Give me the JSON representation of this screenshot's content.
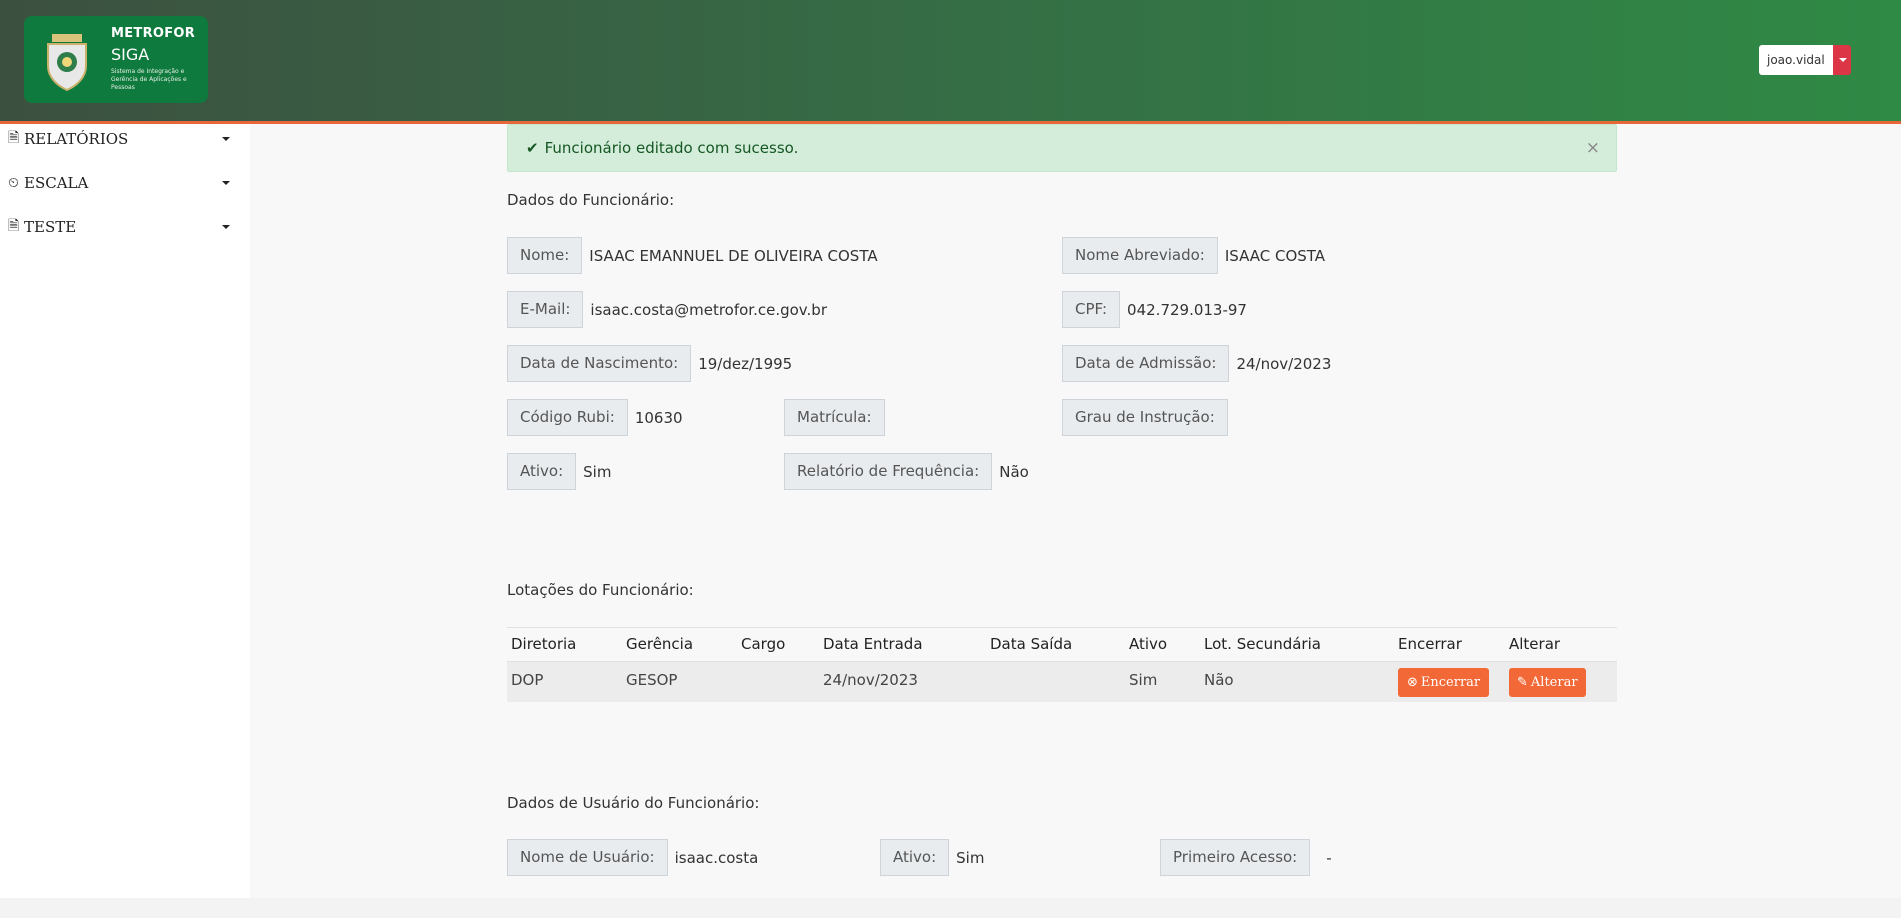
{
  "header": {
    "logo_title": "METROFOR",
    "logo_sub": "SIGA",
    "logo_desc": "Sistema de Integração e Gerência de Aplicações e Pessoas",
    "user": "joao.vidal"
  },
  "sidebar": {
    "items": [
      {
        "label": "RELATÓRIOS",
        "icon": "file-icon"
      },
      {
        "label": "ESCALA",
        "icon": "clock-icon"
      },
      {
        "label": "TESTE",
        "icon": "file-icon"
      }
    ]
  },
  "alert": {
    "message": "Funcionário editado com sucesso.",
    "close": "×"
  },
  "employee": {
    "section_title": "Dados do Funcionário:",
    "nome_label": "Nome:",
    "nome": "ISAAC EMANNUEL DE OLIVEIRA COSTA",
    "nome_abrev_label": "Nome Abreviado:",
    "nome_abrev": "ISAAC COSTA",
    "email_label": "E-Mail:",
    "email": "isaac.costa@metrofor.ce.gov.br",
    "cpf_label": "CPF:",
    "cpf": "042.729.013-97",
    "nasc_label": "Data de Nascimento:",
    "nasc": "19/dez/1995",
    "admissao_label": "Data de Admissão:",
    "admissao": "24/nov/2023",
    "rubi_label": "Código Rubi:",
    "rubi": "10630",
    "matricula_label": "Matrícula:",
    "matricula": "",
    "grau_label": "Grau de Instrução:",
    "grau": "",
    "ativo_label": "Ativo:",
    "ativo": "Sim",
    "freq_label": "Relatório de Frequência:",
    "freq": "Não"
  },
  "lotacoes": {
    "section_title": "Lotações do Funcionário:",
    "headers": [
      "Diretoria",
      "Gerência",
      "Cargo",
      "Data Entrada",
      "Data Saída",
      "Ativo",
      "Lot. Secundária",
      "Encerrar",
      "Alterar"
    ],
    "rows": [
      {
        "diretoria": "DOP",
        "gerencia": "GESOP",
        "cargo": "",
        "entrada": "24/nov/2023",
        "saida": "",
        "ativo": "Sim",
        "secundaria": "Não",
        "encerrar": "Encerrar",
        "alterar": "Alterar"
      }
    ]
  },
  "usuario": {
    "section_title": "Dados de Usuário do Funcionário:",
    "nome_label": "Nome de Usuário:",
    "nome": "isaac.costa",
    "ativo_label": "Ativo:",
    "ativo": "Sim",
    "primeiro_label": "Primeiro Acesso:",
    "primeiro": "-"
  }
}
